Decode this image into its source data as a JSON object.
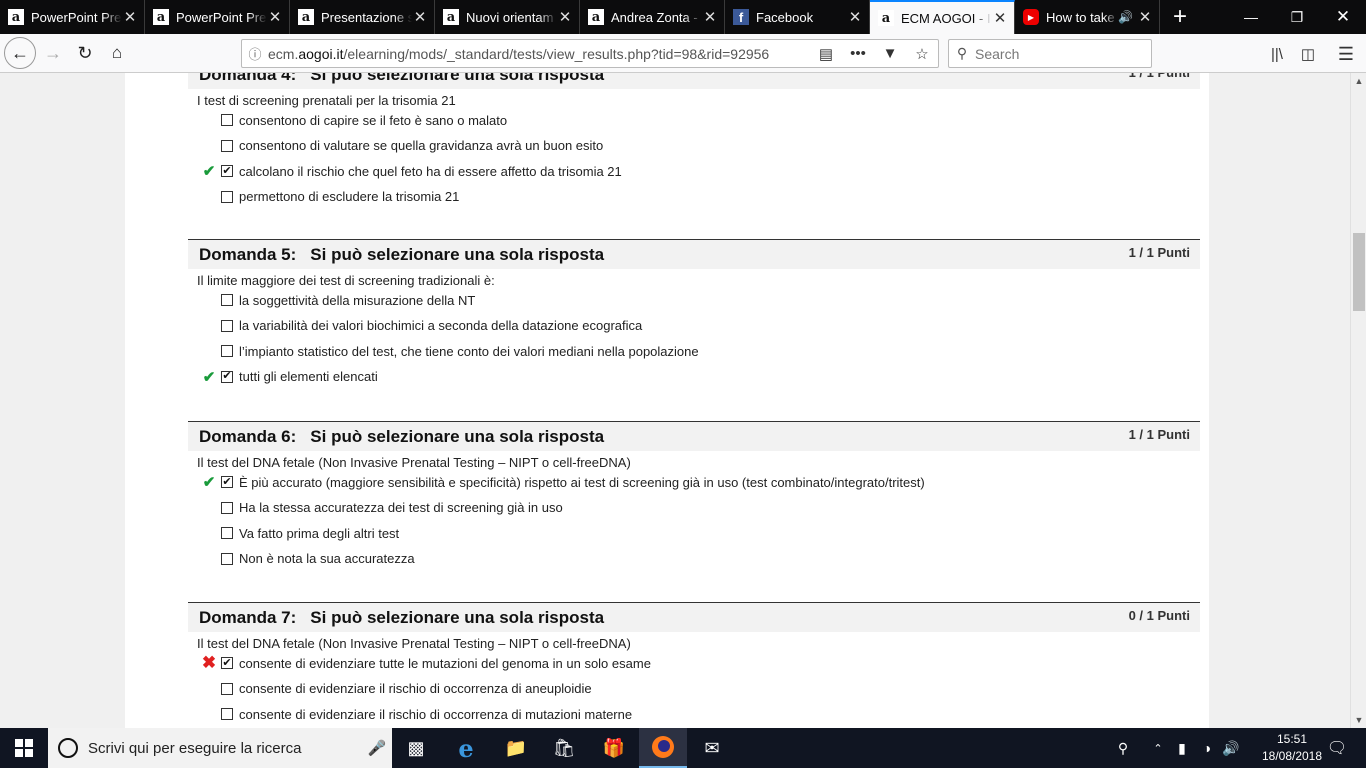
{
  "browser": {
    "tabs": [
      {
        "icon": "aogoi-favicon",
        "label": "PowerPoint Pres",
        "active": false
      },
      {
        "icon": "aogoi-favicon",
        "label": "PowerPoint Pres",
        "active": false
      },
      {
        "icon": "aogoi-favicon",
        "label": "Presentazione st",
        "active": false
      },
      {
        "icon": "aogoi-favicon",
        "label": "Nuovi orientam",
        "active": false
      },
      {
        "icon": "aogoi-favicon",
        "label": "Andrea Zonta -",
        "active": false
      },
      {
        "icon": "facebook-favicon",
        "label": "Facebook",
        "active": false
      },
      {
        "icon": "aogoi-favicon",
        "label": "ECM AOGOI - II",
        "active": true
      },
      {
        "icon": "youtube-favicon",
        "label": "How to take",
        "active": false
      }
    ],
    "url_prefix": "ecm.",
    "url_domain": "aogoi.it",
    "url_path": "/elearning/mods/_standard/tests/view_results.php?tid=98&rid=92956",
    "search_placeholder": "Search",
    "accent_color": "#0a84ff"
  },
  "questions": [
    {
      "title": "Domanda 4:",
      "mode": "Si può selezionare una sola risposta",
      "points": "1 / 1 Punti",
      "text": "I test di screening prenatali per la trisomia 21",
      "answers": [
        {
          "label": "consentono di capire se il feto è sano o malato",
          "checked": false,
          "mark": ""
        },
        {
          "label": "consentono di valutare se quella gravidanza avrà un buon esito",
          "checked": false,
          "mark": ""
        },
        {
          "label": "calcolano il rischio che quel feto ha di essere affetto da trisomia 21",
          "checked": true,
          "mark": "correct"
        },
        {
          "label": "permettono di escludere la trisomia 21",
          "checked": false,
          "mark": ""
        }
      ]
    },
    {
      "title": "Domanda 5:",
      "mode": "Si può selezionare una sola risposta",
      "points": "1 / 1 Punti",
      "text": "Il limite maggiore dei test di screening tradizionali è:",
      "answers": [
        {
          "label": "la soggettività della misurazione della NT",
          "checked": false,
          "mark": ""
        },
        {
          "label": "la variabilità dei valori biochimici a seconda della datazione ecografica",
          "checked": false,
          "mark": ""
        },
        {
          "label": "l’impianto statistico del test, che tiene conto dei valori mediani nella popolazione",
          "checked": false,
          "mark": ""
        },
        {
          "label": "tutti gli elementi elencati",
          "checked": true,
          "mark": "correct"
        }
      ]
    },
    {
      "title": "Domanda 6:",
      "mode": "Si può selezionare una sola risposta",
      "points": "1 / 1 Punti",
      "text": "Il test del DNA fetale (Non Invasive Prenatal Testing – NIPT o cell-freeDNA)",
      "answers": [
        {
          "label": "È più accurato (maggiore sensibilità e specificità) rispetto ai test di screening già in uso (test combinato/integrato/tritest)",
          "checked": true,
          "mark": "correct"
        },
        {
          "label": "Ha la stessa accuratezza dei test di screening già in uso",
          "checked": false,
          "mark": ""
        },
        {
          "label": "Va fatto prima degli altri test",
          "checked": false,
          "mark": ""
        },
        {
          "label": "Non è nota la sua accuratezza",
          "checked": false,
          "mark": ""
        }
      ]
    },
    {
      "title": "Domanda 7:",
      "mode": "Si può selezionare una sola risposta",
      "points": "0 / 1 Punti",
      "text": "Il test del DNA fetale (Non Invasive Prenatal Testing – NIPT o cell-freeDNA)",
      "answers": [
        {
          "label": "consente di evidenziare tutte le mutazioni del genoma in un solo esame",
          "checked": true,
          "mark": "wrong"
        },
        {
          "label": "consente di evidenziare il rischio di occorrenza di aneuploidie",
          "checked": false,
          "mark": ""
        },
        {
          "label": "consente di evidenziare il rischio di occorrenza di mutazioni materne",
          "checked": false,
          "mark": ""
        }
      ]
    }
  ],
  "colors": {
    "correct": "#1a9b3b",
    "wrong": "#e02020"
  },
  "taskbar": {
    "search_placeholder": "Scrivi qui per eseguire la ricerca",
    "time": "15:51",
    "date": "18/08/2018"
  }
}
